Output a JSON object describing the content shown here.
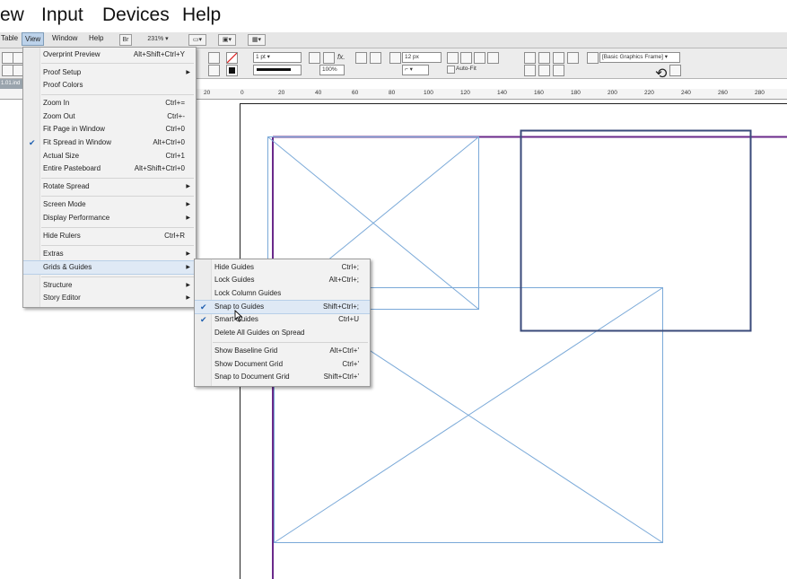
{
  "outer_menu": {
    "items": [
      "ew",
      "Input",
      "Devices",
      "Help"
    ]
  },
  "app_menu": {
    "items": [
      "Table",
      "View",
      "Window",
      "Help"
    ],
    "br_label": "Br",
    "zoom": "231%",
    "active": "View"
  },
  "control_panel": {
    "stroke_weight": "1 pt",
    "spacing": "12 px",
    "scale": "100%",
    "autofit_label": "Auto-Fit",
    "frame_style": "[Basic Graphics Frame]",
    "fx_label": "fx."
  },
  "doc_tab": {
    "label": "1.01.ind"
  },
  "ruler": {
    "labels": [
      "20",
      "0",
      "20",
      "40",
      "60",
      "80",
      "100",
      "120",
      "140",
      "160",
      "180",
      "200",
      "220",
      "240",
      "260",
      "280"
    ]
  },
  "view_menu": {
    "items": [
      {
        "label": "Overprint Preview",
        "shortcut": "Alt+Shift+Ctrl+Y"
      },
      {
        "label": "Proof Setup",
        "arrow": "▶"
      },
      {
        "label": "Proof Colors"
      },
      {
        "label": "Zoom In",
        "shortcut": "Ctrl+="
      },
      {
        "label": "Zoom Out",
        "shortcut": "Ctrl+-"
      },
      {
        "label": "Fit Page in Window",
        "shortcut": "Ctrl+0"
      },
      {
        "label": "Fit Spread in Window",
        "shortcut": "Alt+Ctrl+0",
        "check": "✔"
      },
      {
        "label": "Actual Size",
        "shortcut": "Ctrl+1"
      },
      {
        "label": "Entire Pasteboard",
        "shortcut": "Alt+Shift+Ctrl+0"
      },
      {
        "label": "Rotate Spread",
        "arrow": "▶"
      },
      {
        "label": "Screen Mode",
        "arrow": "▶"
      },
      {
        "label": "Display Performance",
        "arrow": "▶"
      },
      {
        "label": "Hide Rulers",
        "shortcut": "Ctrl+R"
      },
      {
        "label": "Extras",
        "arrow": "▶"
      },
      {
        "label": "Grids & Guides",
        "arrow": "▶"
      },
      {
        "label": "Structure",
        "arrow": "▶"
      },
      {
        "label": "Story Editor",
        "arrow": "▶"
      }
    ]
  },
  "grids_menu": {
    "items": [
      {
        "label": "Hide Guides",
        "shortcut": "Ctrl+;"
      },
      {
        "label": "Lock Guides",
        "shortcut": "Alt+Ctrl+;"
      },
      {
        "label": "Lock Column Guides"
      },
      {
        "label": "Snap to Guides",
        "shortcut": "Shift+Ctrl+;",
        "check": "✔"
      },
      {
        "label": "Smart Guides",
        "shortcut": "Ctrl+U",
        "check": "✔"
      },
      {
        "label": "Delete All Guides on Spread"
      },
      {
        "label": "Show Baseline Grid",
        "shortcut": "Alt+Ctrl+'"
      },
      {
        "label": "Show Document Grid",
        "shortcut": "Ctrl+'"
      },
      {
        "label": "Snap to Document Grid",
        "shortcut": "Shift+Ctrl+'"
      }
    ]
  },
  "colors": {
    "frame_stroke": "#3a4a7a",
    "placeholder_frame": "#7aa9d8",
    "margin_line": "#6a2a8a",
    "menu_bg": "#f2f2f2",
    "highlight": "#dfe9f5"
  }
}
